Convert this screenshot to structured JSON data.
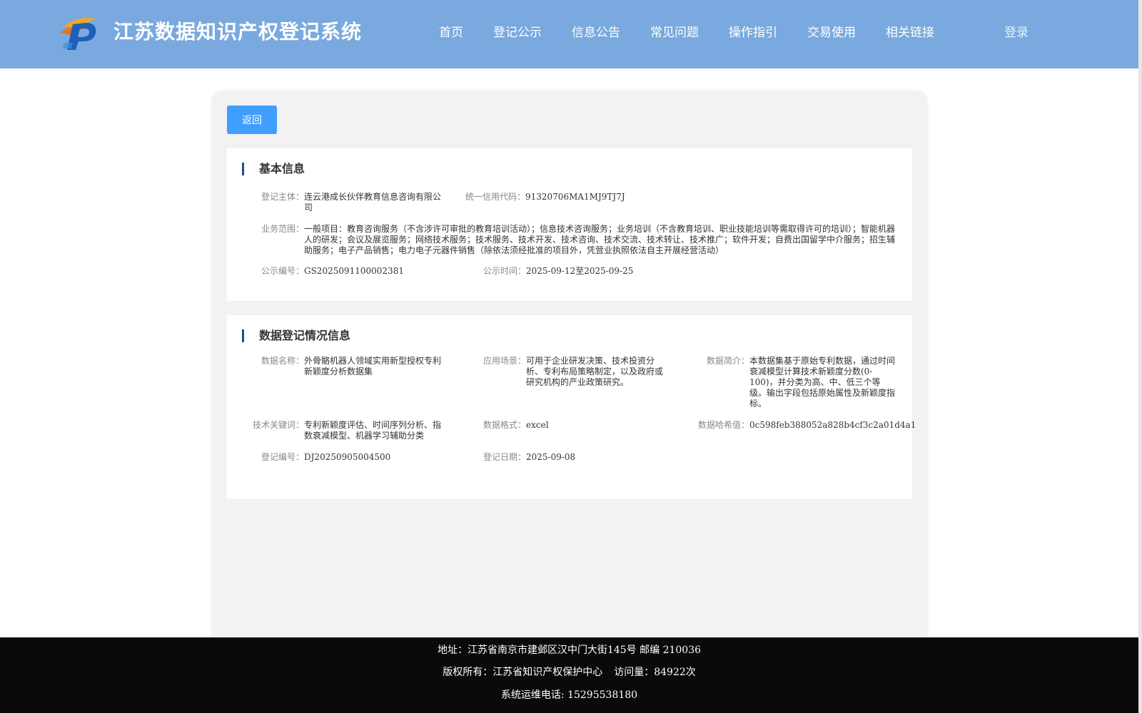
{
  "header": {
    "site_title": "江苏数据知识产权登记系统",
    "nav": [
      "首页",
      "登记公示",
      "信息公告",
      "常见问题",
      "操作指引",
      "交易使用",
      "相关链接"
    ],
    "login": "登录"
  },
  "back_label": "返回",
  "basic": {
    "title": "基本信息",
    "subject_label": "登记主体：",
    "subject": "连云港成长伙伴教育信息咨询有限公司",
    "credit_label": "统一信用代码：",
    "credit": "91320706MA1MJ9TJ7J",
    "scope_label": "业务范围：",
    "scope": "一般项目：教育咨询服务（不含涉许可审批的教育培训活动）；信息技术咨询服务；业务培训（不含教育培训、职业技能培训等需取得许可的培训）；智能机器人的研发；会议及展览服务；网络技术服务；技术服务、技术开发、技术咨询、技术交流、技术转让、技术推广；软件开发；自费出国留学中介服务；招生辅助服务；电子产品销售；电力电子元器件销售（除依法须经批准的项目外，凭营业执照依法自主开展经营活动）",
    "notice_no_label": "公示编号：",
    "notice_no": "GS2025091100002381",
    "notice_time_label": "公示时间：",
    "notice_time": "2025-09-12至2025-09-25"
  },
  "data_info": {
    "title": "数据登记情况信息",
    "name_label": "数据名称：",
    "name": "外骨骼机器人领域实用新型授权专利新颖度分析数据集",
    "scene_label": "应用场景：",
    "scene": "可用于企业研发决策、技术投资分析、专利布局策略制定，以及政府或研究机构的产业政策研究。",
    "intro_label": "数据简介：",
    "intro": "本数据集基于原始专利数据，通过时间衰减模型计算技术新颖度分数(0-100)，并分类为高、中、低三个等级。输出字段包括原始属性及新颖度指标。",
    "keywords_label": "技术关键词：",
    "keywords": "专利新颖度评估、时间序列分析、指数衰减模型、机器学习辅助分类",
    "format_label": "数据格式：",
    "format": "excel",
    "hash_label": "数据哈希值：",
    "hash": "0c598feb388052a828b4cf3c2a01d4a1",
    "reg_no_label": "登记编号：",
    "reg_no": "DJ20250905004500",
    "reg_date_label": "登记日期：",
    "reg_date": "2025-09-08"
  },
  "footer": {
    "address": "地址：江苏省南京市建邺区汉中门大街145号 邮编 210036",
    "copyright": "版权所有：江苏省知识产权保护中心",
    "visits": "访问量：84922次",
    "phone": "系统运维电话: 15295538180"
  },
  "colors": {
    "header_bg": "#79a9de",
    "button_bg": "#409eff",
    "title_accent": "#1f4e8c",
    "footer_bg": "#0a0a0a"
  }
}
